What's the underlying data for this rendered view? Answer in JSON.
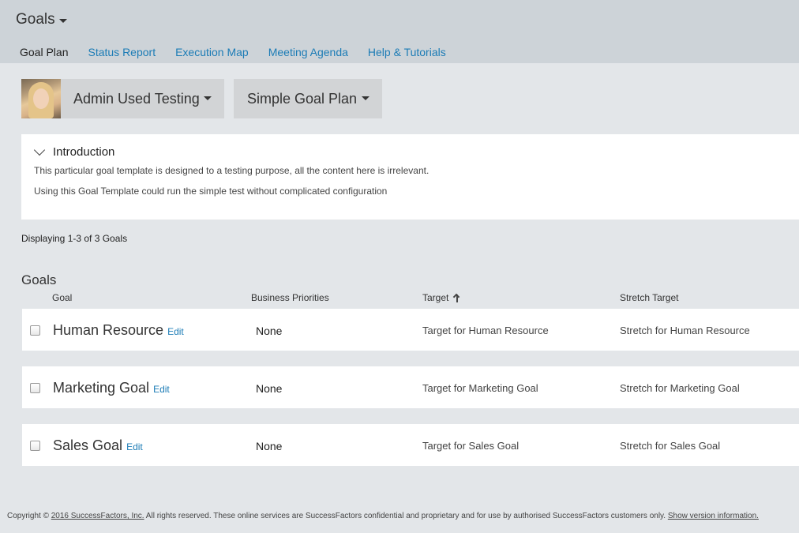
{
  "header": {
    "module_title": "Goals",
    "tabs": [
      {
        "label": "Goal Plan"
      },
      {
        "label": "Status Report"
      },
      {
        "label": "Execution Map"
      },
      {
        "label": "Meeting Agenda"
      },
      {
        "label": "Help & Tutorials"
      }
    ]
  },
  "selectors": {
    "user_name": "Admin Used Testing",
    "plan_name": "Simple Goal Plan"
  },
  "introduction": {
    "title": "Introduction",
    "line1": "This particular goal template is designed to a testing purpose, all the content here is irrelevant.",
    "line2": "Using this Goal Template could run the simple test without complicated configuration"
  },
  "list": {
    "count_text": "Displaying 1-3 of 3 Goals",
    "section_title": "Goals",
    "columns": {
      "goal": "Goal",
      "business_priorities": "Business Priorities",
      "target": "Target",
      "stretch_target": "Stretch Target"
    },
    "edit_label": "Edit",
    "rows": [
      {
        "goal": "Human Resource",
        "priorities": "None",
        "target": "Target for Human Resource",
        "stretch": "Stretch for Human Resource"
      },
      {
        "goal": "Marketing Goal",
        "priorities": "None",
        "target": "Target for Marketing Goal",
        "stretch": "Stretch for Marketing Goal"
      },
      {
        "goal": "Sales Goal",
        "priorities": "None",
        "target": "Target for Sales Goal",
        "stretch": "Stretch for Sales Goal"
      }
    ]
  },
  "footer": {
    "prefix": "Copyright © ",
    "company_link": "2016 SuccessFactors, Inc.",
    "middle": " All rights reserved. These online services are SuccessFactors confidential and proprietary and for use by authorised SuccessFactors customers only. ",
    "version_link": "Show version information."
  },
  "colors": {
    "header_bg": "#cdd3d8",
    "page_bg": "#e3e6e9",
    "link": "#1c7cb6"
  }
}
